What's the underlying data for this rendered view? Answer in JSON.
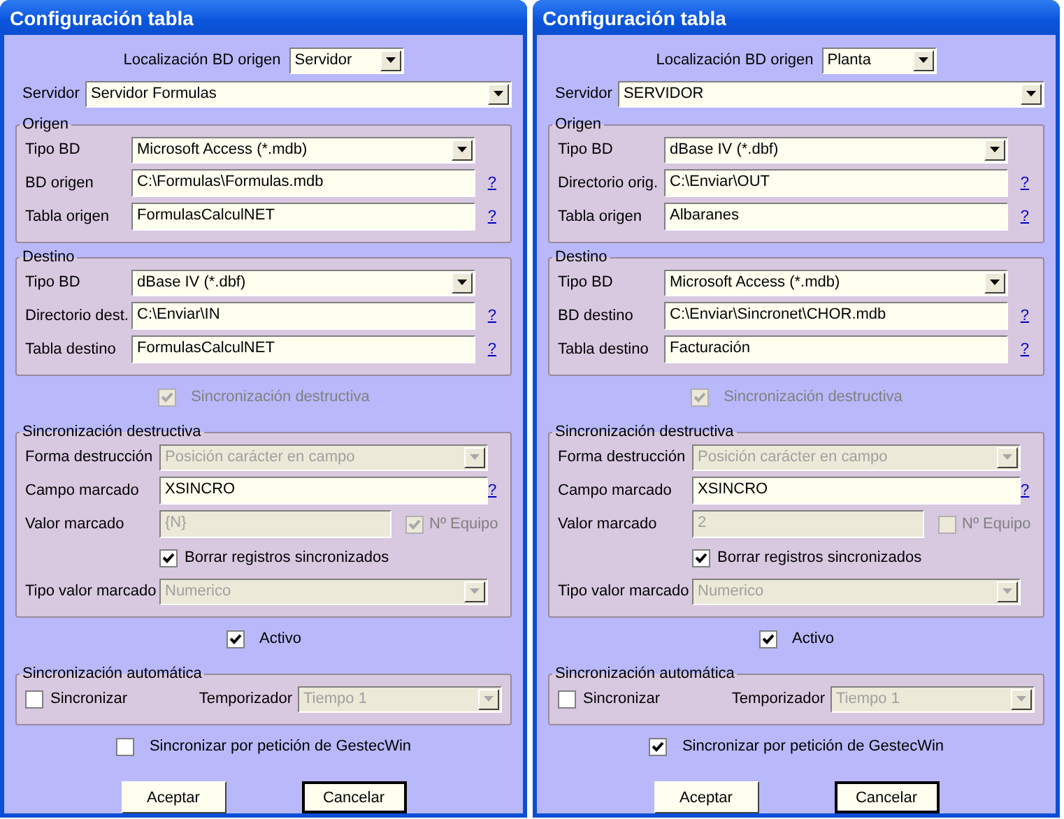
{
  "windows": [
    {
      "title": "Configuración tabla",
      "location": {
        "label": "Localización BD origen",
        "value": "Servidor"
      },
      "server": {
        "label": "Servidor",
        "value": "Servidor Formulas"
      },
      "origin": {
        "legend": "Origen",
        "rows": [
          {
            "kind": "select",
            "label": "Tipo BD",
            "value": "Microsoft Access (*.mdb)",
            "disabled": false
          },
          {
            "kind": "text",
            "label": "BD origen",
            "value": "C:\\Formulas\\Formulas.mdb",
            "disabled": false,
            "help": "?"
          },
          {
            "kind": "text",
            "label": "Tabla origen",
            "value": "FormulasCalculNET",
            "disabled": false,
            "help": "?"
          }
        ]
      },
      "destination": {
        "legend": "Destino",
        "rows": [
          {
            "kind": "select",
            "label": "Tipo BD",
            "value": "dBase IV (*.dbf)",
            "disabled": false
          },
          {
            "kind": "text",
            "label": "Directorio dest.",
            "value": "C:\\Enviar\\IN",
            "disabled": false,
            "help": "?"
          },
          {
            "kind": "text",
            "label": "Tabla destino",
            "value": "FormulasCalculNET",
            "disabled": false,
            "help": "?"
          }
        ]
      },
      "destructive_check": {
        "label": "Sincronización destructiva",
        "checked": true,
        "disabled": true
      },
      "destructive": {
        "legend": "Sincronización destructiva",
        "rows": [
          {
            "kind": "select",
            "label": "Forma destrucción",
            "value": "Posición carácter en campo",
            "disabled": true
          },
          {
            "kind": "text",
            "label": "Campo marcado",
            "value": "XSINCRO",
            "disabled": false,
            "help": "?"
          },
          {
            "kind": "text",
            "label": "Valor marcado",
            "value": "{N}",
            "disabled": true,
            "option": {
              "label": "Nº Equipo",
              "checked": true,
              "disabled": true
            }
          },
          {
            "kind": "checkbox",
            "label": "Borrar registros sincronizados",
            "checked": true,
            "disabled": false
          },
          {
            "kind": "select",
            "label": "Tipo valor marcado",
            "value": "Numerico",
            "disabled": true
          }
        ]
      },
      "active": {
        "label": "Activo",
        "checked": true
      },
      "auto": {
        "legend": "Sincronización automática",
        "sync": {
          "label": "Sincronizar",
          "checked": false
        },
        "timer": {
          "label": "Temporizador",
          "value": "Tiempo 1",
          "disabled": true
        }
      },
      "on_request": {
        "label": "Sincronizar por petición de GestecWin",
        "checked": false
      },
      "buttons": [
        {
          "label": "Aceptar",
          "default": false
        },
        {
          "label": "Cancelar",
          "default": true
        }
      ]
    },
    {
      "title": "Configuración tabla",
      "location": {
        "label": "Localización BD origen",
        "value": "Planta"
      },
      "server": {
        "label": "Servidor",
        "value": "SERVIDOR"
      },
      "origin": {
        "legend": "Origen",
        "rows": [
          {
            "kind": "select",
            "label": "Tipo BD",
            "value": "dBase IV (*.dbf)",
            "disabled": false
          },
          {
            "kind": "text",
            "label": "Directorio orig.",
            "value": "C:\\Enviar\\OUT",
            "disabled": false,
            "help": "?"
          },
          {
            "kind": "text",
            "label": "Tabla origen",
            "value": "Albaranes",
            "disabled": false,
            "help": "?"
          }
        ]
      },
      "destination": {
        "legend": "Destino",
        "rows": [
          {
            "kind": "select",
            "label": "Tipo BD",
            "value": "Microsoft Access (*.mdb)",
            "disabled": false
          },
          {
            "kind": "text",
            "label": "BD destino",
            "value": "C:\\Enviar\\Sincronet\\CHOR.mdb",
            "disabled": false,
            "help": "?"
          },
          {
            "kind": "text",
            "label": "Tabla destino",
            "value": "Facturación",
            "disabled": false,
            "help": "?"
          }
        ]
      },
      "destructive_check": {
        "label": "Sincronización destructiva",
        "checked": true,
        "disabled": true
      },
      "destructive": {
        "legend": "Sincronización destructiva",
        "rows": [
          {
            "kind": "select",
            "label": "Forma destrucción",
            "value": "Posición carácter en campo",
            "disabled": true
          },
          {
            "kind": "text",
            "label": "Campo marcado",
            "value": "XSINCRO",
            "disabled": false,
            "help": "?"
          },
          {
            "kind": "text",
            "label": "Valor marcado",
            "value": "2",
            "disabled": true,
            "option": {
              "label": "Nº Equipo",
              "checked": false,
              "disabled": true
            }
          },
          {
            "kind": "checkbox",
            "label": "Borrar registros sincronizados",
            "checked": true,
            "disabled": false
          },
          {
            "kind": "select",
            "label": "Tipo valor marcado",
            "value": "Numerico",
            "disabled": true
          }
        ]
      },
      "active": {
        "label": "Activo",
        "checked": true
      },
      "auto": {
        "legend": "Sincronización automática",
        "sync": {
          "label": "Sincronizar",
          "checked": false
        },
        "timer": {
          "label": "Temporizador",
          "value": "Tiempo 1",
          "disabled": true
        }
      },
      "on_request": {
        "label": "Sincronizar por petición de GestecWin",
        "checked": true
      },
      "buttons": [
        {
          "label": "Aceptar",
          "default": false
        },
        {
          "label": "Cancelar",
          "default": true
        }
      ]
    }
  ]
}
